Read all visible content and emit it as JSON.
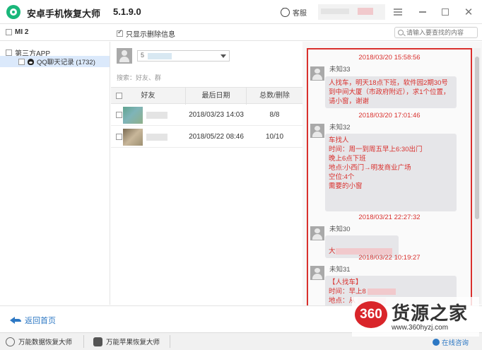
{
  "titlebar": {
    "app_name": "安卓手机恢复大师",
    "version": "5.1.9.0",
    "service_label": "客服"
  },
  "toolbar": {
    "device_name": "MI 2",
    "filter_label": "只显示删除信息",
    "filter_checked": true,
    "search_placeholder": "请输入要查找的内容"
  },
  "tree": {
    "root_label": "第三方APP",
    "child_label": "QQ聊天记录 (1732)",
    "child_icon": "qq-icon"
  },
  "middle": {
    "account_prefix": "5",
    "friend_search_placeholder": "搜索：好友、群",
    "columns": [
      "好友",
      "最后日期",
      "总数/删除"
    ],
    "rows": [
      {
        "last_date": "2018/03/23 14:03",
        "count": "8/8"
      },
      {
        "last_date": "2018/05/22 08:46",
        "count": "10/10"
      }
    ]
  },
  "chat": {
    "messages": [
      {
        "time": "2018/03/20 15:58:56",
        "sender": "未知33",
        "text": "人找车，明天18点下班，软件园2期30号到中间大厦（市政府附近），求1个位置，请小窗，谢谢"
      },
      {
        "time": "2018/03/20 17:01:46",
        "sender": "未知32",
        "text": "车找人\n时间：周一到周五早上6:30出门\n晚上6点下班\n地点:小西门→明发商业广场\n空位:4个\n需要的小窗"
      },
      {
        "time": "2018/03/21 22:27:32",
        "sender": "未知30",
        "text": "大"
      },
      {
        "time": "2018/03/22 10:19:27",
        "sender": "未知31",
        "text_lines": [
          "【人找车】",
          "时间：早上8",
          "地点：从"
        ]
      }
    ]
  },
  "footer": {
    "back_label": "返回首页",
    "task1_label": "万能数据恢复大师",
    "task2_label": "万能苹果恢复大师",
    "consult_label": "在线咨询"
  },
  "watermark": {
    "badge": "360",
    "name": "货源之家",
    "url": "www.360hyzj.com"
  },
  "colors": {
    "accent_red": "#d9302d",
    "brand_green": "#19b77a",
    "link_blue": "#2d78c4"
  }
}
